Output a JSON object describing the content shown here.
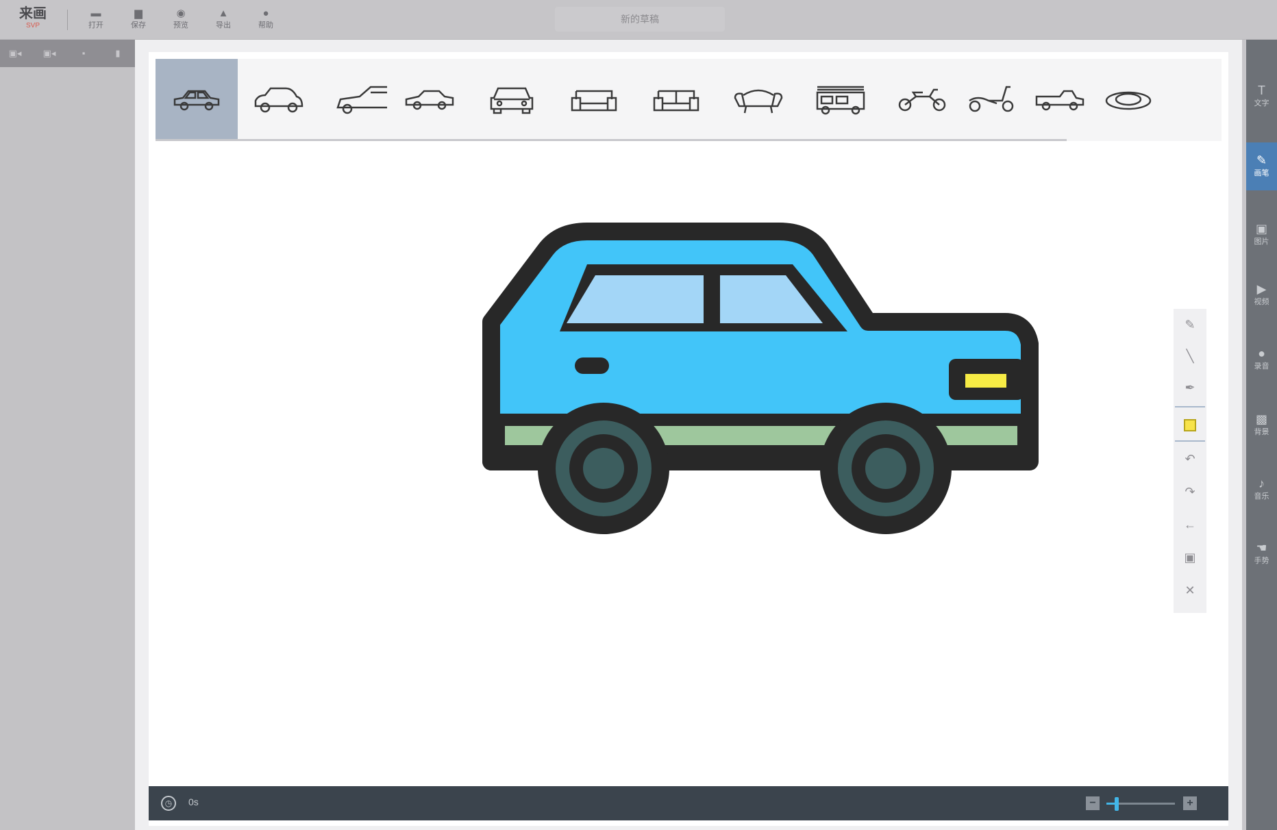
{
  "app": {
    "logo_text": "来画",
    "logo_sub": "SVP"
  },
  "toolbar": {
    "items": [
      {
        "label": "打开",
        "icon": "folder-icon",
        "glyph": "▬"
      },
      {
        "label": "保存",
        "icon": "save-icon",
        "glyph": "▆"
      },
      {
        "label": "预览",
        "icon": "eye-icon",
        "glyph": "◉"
      },
      {
        "label": "导出",
        "icon": "export-icon",
        "glyph": "▲"
      },
      {
        "label": "帮助",
        "icon": "help-icon",
        "glyph": "●"
      }
    ],
    "document_title": "新的草稿"
  },
  "left_panel": {
    "buttons": [
      {
        "name": "add-scene-icon",
        "glyph": "▣◂"
      },
      {
        "name": "insert-scene-icon",
        "glyph": "▣◂"
      },
      {
        "name": "copy-scene-icon",
        "glyph": "▪"
      },
      {
        "name": "delete-scene-icon",
        "glyph": "▮"
      }
    ]
  },
  "shape_library": {
    "items": [
      {
        "name": "sedan-shape",
        "selected": true
      },
      {
        "name": "compact-car-shape",
        "selected": false
      },
      {
        "name": "car-outline-shape",
        "selected": false
      },
      {
        "name": "small-car-shape",
        "selected": false
      },
      {
        "name": "car-front-shape",
        "selected": false
      },
      {
        "name": "loveseat-shape",
        "selected": false
      },
      {
        "name": "sofa-shape",
        "selected": false
      },
      {
        "name": "armchair-shape",
        "selected": false
      },
      {
        "name": "fire-truck-shape",
        "selected": false
      },
      {
        "name": "motorbike-shape",
        "selected": false
      },
      {
        "name": "scooter-shape",
        "selected": false
      },
      {
        "name": "pickup-truck-shape",
        "selected": false
      },
      {
        "name": "ufo-shape",
        "selected": false
      }
    ]
  },
  "canvas": {
    "colors": {
      "body": "#42c5f9",
      "outline": "#282828",
      "window": "#a3d6f7",
      "stripe": "#9ec79d",
      "wheel_rim": "#3c5d5e",
      "headlight": "#f7ec45"
    }
  },
  "float_tools": {
    "items": [
      {
        "name": "pencil-icon",
        "glyph": "✎"
      },
      {
        "name": "brush-icon",
        "glyph": "╲"
      },
      {
        "name": "pen-icon",
        "glyph": "✒"
      },
      {
        "name": "color-swatch",
        "glyph": ""
      },
      {
        "name": "undo-icon",
        "glyph": "↶"
      },
      {
        "name": "redo-icon",
        "glyph": "↷"
      },
      {
        "name": "back-arrow-icon",
        "glyph": "←"
      },
      {
        "name": "save-icon",
        "glyph": "▣"
      },
      {
        "name": "close-icon",
        "glyph": "✕"
      }
    ],
    "active_color": "#f7e34a"
  },
  "bottom_bar": {
    "time": "0s",
    "zoom_level": 0.15
  },
  "right_sidebar": {
    "items": [
      {
        "label": "文字",
        "icon": "text-icon",
        "glyph": "T",
        "active": false
      },
      {
        "label": "画笔",
        "icon": "brush-icon",
        "glyph": "✎",
        "active": true
      },
      {
        "label": "图片",
        "icon": "image-icon",
        "glyph": "▣",
        "active": false
      },
      {
        "label": "视频",
        "icon": "video-icon",
        "glyph": "▶",
        "active": false
      },
      {
        "label": "录音",
        "icon": "record-icon",
        "glyph": "●",
        "active": false
      },
      {
        "label": "背景",
        "icon": "background-icon",
        "glyph": "▩",
        "active": false
      },
      {
        "label": "音乐",
        "icon": "music-icon",
        "glyph": "♪",
        "active": false
      },
      {
        "label": "手势",
        "icon": "hand-icon",
        "glyph": "☚",
        "active": false
      }
    ]
  }
}
